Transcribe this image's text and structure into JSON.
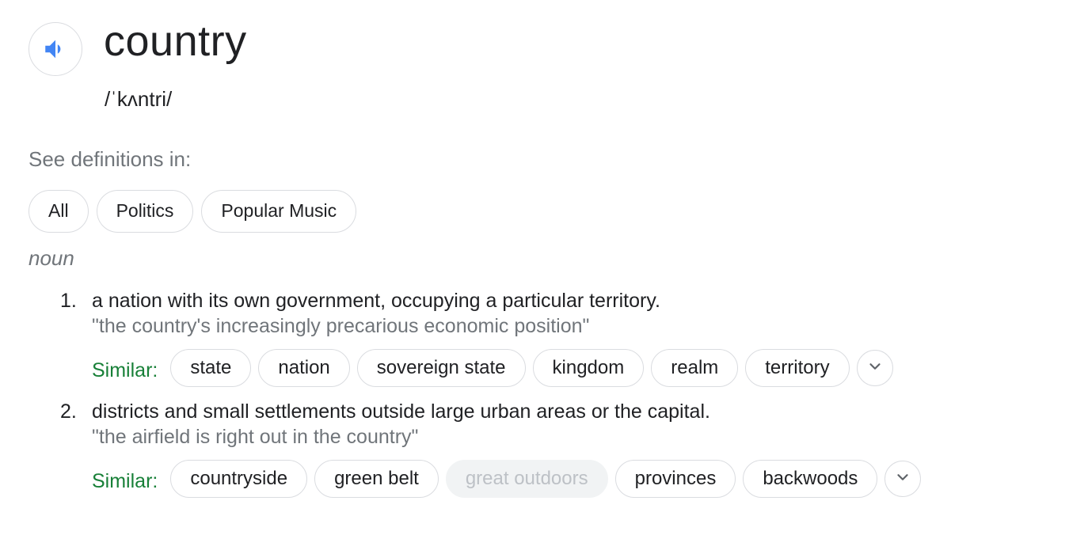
{
  "entry": {
    "word": "country",
    "phonetic": "/ˈkʌntri/"
  },
  "icons": {
    "speaker": "speaker-icon",
    "expand": "chevron-down-icon",
    "accent_color": "#4285f4"
  },
  "see_definitions": {
    "label": "See definitions in:",
    "chips": [
      "All",
      "Politics",
      "Popular Music"
    ]
  },
  "part_of_speech": "noun",
  "senses": [
    {
      "number": "1.",
      "definition": "a nation with its own government, occupying a particular territory.",
      "example": "\"the country's increasingly precarious economic position\"",
      "similar_label": "Similar:",
      "similar": [
        {
          "text": "state",
          "disabled": false
        },
        {
          "text": "nation",
          "disabled": false
        },
        {
          "text": "sovereign state",
          "disabled": false
        },
        {
          "text": "kingdom",
          "disabled": false
        },
        {
          "text": "realm",
          "disabled": false
        },
        {
          "text": "territory",
          "disabled": false
        }
      ]
    },
    {
      "number": "2.",
      "definition": "districts and small settlements outside large urban areas or the capital.",
      "example": "\"the airfield is right out in the country\"",
      "similar_label": "Similar:",
      "similar": [
        {
          "text": "countryside",
          "disabled": false
        },
        {
          "text": "green belt",
          "disabled": false
        },
        {
          "text": "great outdoors",
          "disabled": true
        },
        {
          "text": "provinces",
          "disabled": false
        },
        {
          "text": "backwoods",
          "disabled": false
        }
      ]
    }
  ],
  "colors": {
    "text": "#202124",
    "muted": "#70757a",
    "similar_label": "#188038",
    "chip_border": "#dadce0",
    "disabled_chip_bg": "#f1f3f4",
    "disabled_chip_text": "#bdc1c6"
  }
}
